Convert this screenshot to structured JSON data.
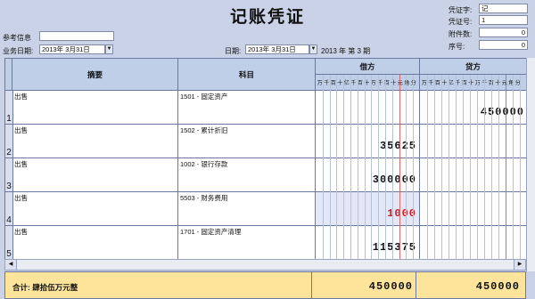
{
  "title": "记账凭证",
  "top_fields": {
    "reference_label": "参考信息",
    "reference_value": "",
    "business_date_label": "业务日期:",
    "business_date_value": "2013年 3月31日",
    "date_label": "日期:",
    "date_value": "2013年 3月31日",
    "period_text": "2013 年 第 3 期"
  },
  "right_fields": {
    "voucher_word_label": "凭证字:",
    "voucher_word_value": "记",
    "voucher_no_label": "凭证号:",
    "voucher_no_value": "1",
    "attachments_label": "附件数:",
    "attachments_value": "0",
    "serial_label": "序号:",
    "serial_value": "0"
  },
  "columns": {
    "summary": "摘要",
    "account": "科目",
    "debit": "借方",
    "credit": "贷方",
    "digit_units": [
      "万",
      "千",
      "百",
      "十",
      "亿",
      "千",
      "百",
      "十",
      "万",
      "千",
      "百",
      "十",
      "元",
      "角",
      "分"
    ]
  },
  "rows": [
    {
      "num": "1",
      "summary": "出售",
      "account": "1501 - 固定资产",
      "debit": "",
      "credit": "450000",
      "debit_color": "#111111"
    },
    {
      "num": "2",
      "summary": "出售",
      "account": "1502 - 累计折旧",
      "debit": "35625",
      "credit": "",
      "debit_color": "#111111"
    },
    {
      "num": "3",
      "summary": "出售",
      "account": "1002 - 银行存款",
      "debit": "300000",
      "credit": "",
      "debit_color": "#111111"
    },
    {
      "num": "4",
      "summary": "出售",
      "account": "5503 - 财务费用",
      "debit": "1000",
      "credit": "",
      "debit_color": "#c0202a"
    },
    {
      "num": "5",
      "summary": "出售",
      "account": "1701 - 固定资产清理",
      "debit": "115375",
      "credit": "",
      "debit_color": "#111111"
    }
  ],
  "total": {
    "label": "合计: 肆拾伍万元整",
    "debit": "450000",
    "credit": "450000"
  }
}
